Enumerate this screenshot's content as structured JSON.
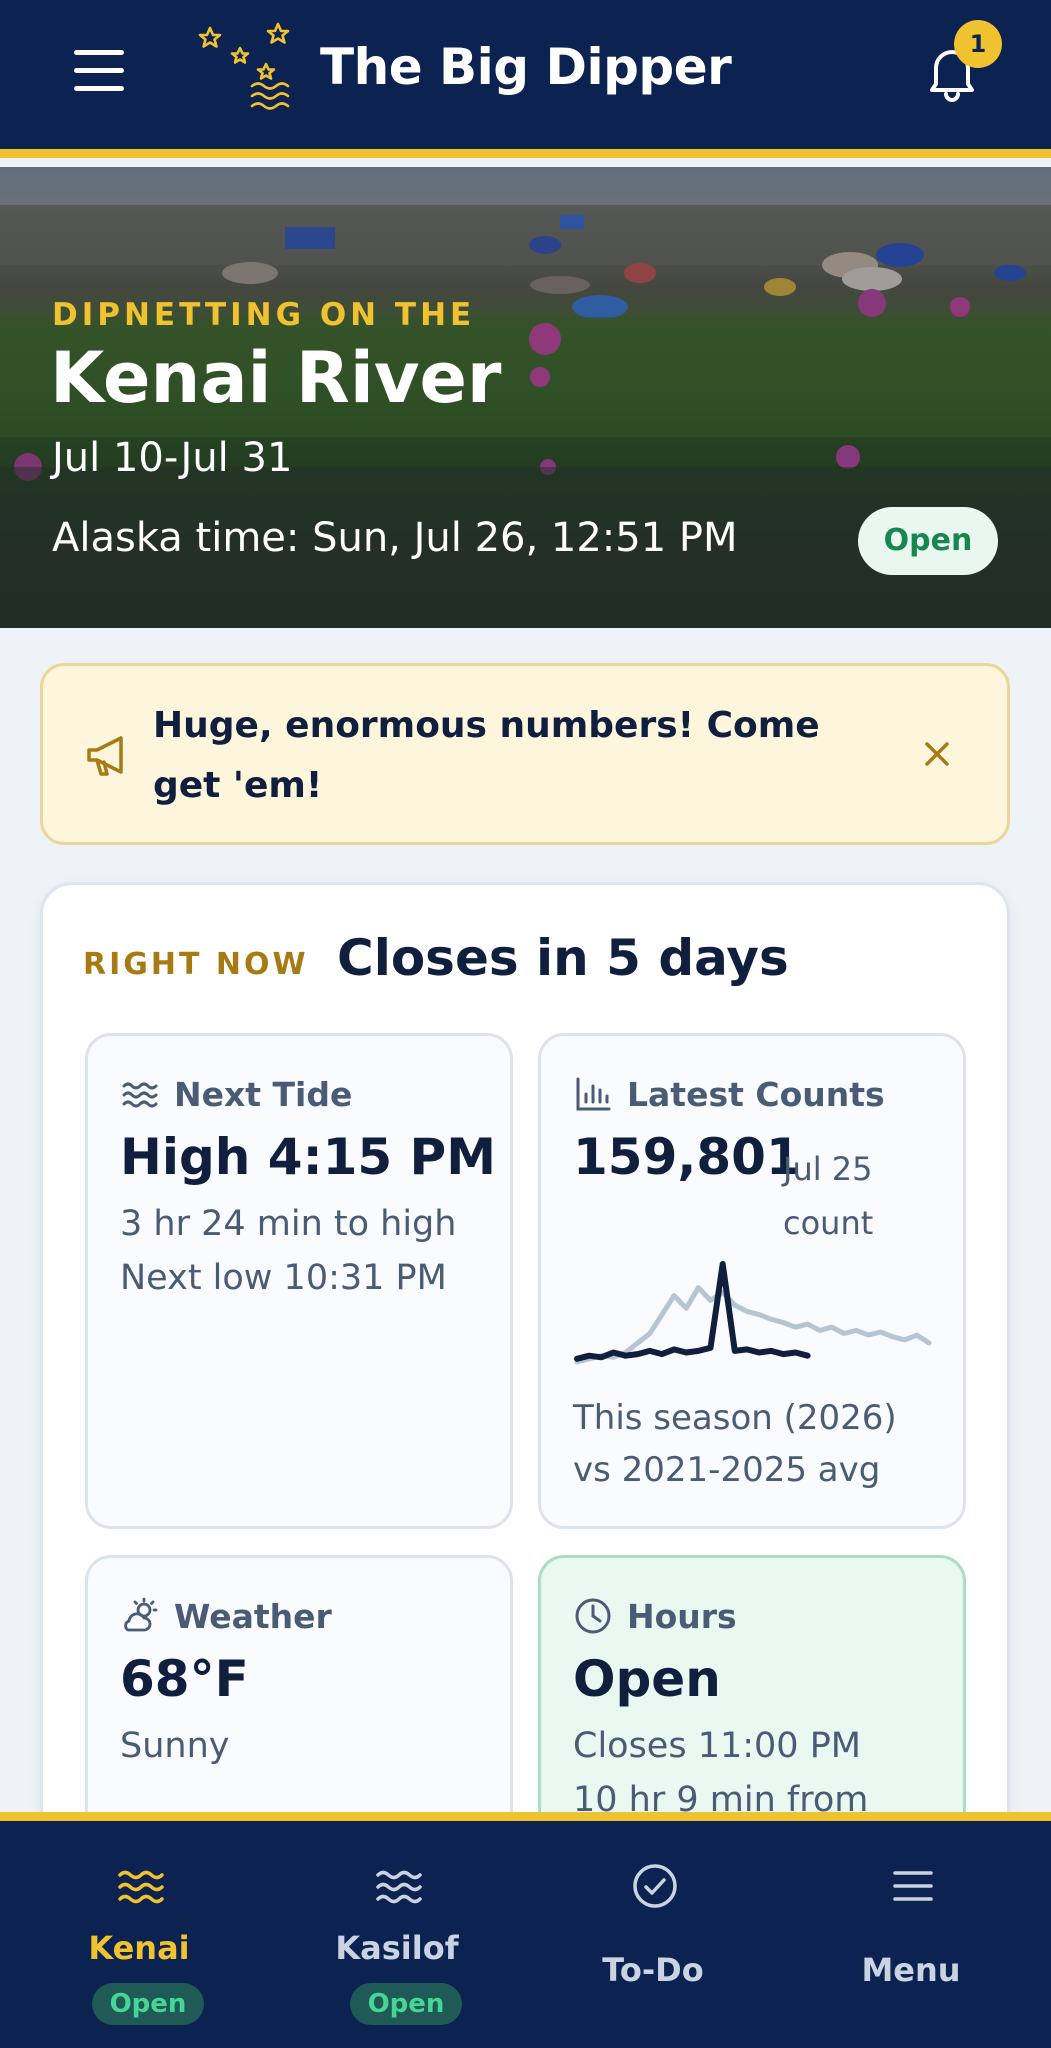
{
  "header": {
    "title": "The Big Dipper",
    "notification_count": "1",
    "icons": {
      "menu": "hamburger-icon",
      "logo": "big-dipper-logo",
      "notifications": "bell-icon"
    }
  },
  "hero": {
    "eyebrow": "DIPNETTING ON THE",
    "title": "Kenai River",
    "dates": "Jul 10-Jul 31",
    "alaska_time": "Alaska time: Sun, Jul 26, 12:51 PM",
    "status": "Open"
  },
  "announcement": {
    "text": "Huge, enormous numbers! Come get 'em!",
    "icons": {
      "megaphone": "megaphone-icon",
      "close": "close-icon"
    }
  },
  "right_now": {
    "eyebrow": "RIGHT NOW",
    "headline": "Closes in 5 days",
    "tide": {
      "label": "Next Tide",
      "value": "High 4:15 PM",
      "line1": "3 hr 24 min to high",
      "line2": "Next low 10:31 PM",
      "icon": "waves-icon"
    },
    "counts": {
      "label": "Latest Counts",
      "value": "159,801",
      "date_line1": "Jul 25",
      "date_line2": "count",
      "legend_line1": "This season (2026)",
      "legend_line2": "vs 2021-2025 avg",
      "icon": "bar-chart-icon"
    },
    "weather": {
      "label": "Weather",
      "value": "68°F",
      "condition": "Sunny",
      "icon": "partly-sunny-icon"
    },
    "hours": {
      "label": "Hours",
      "value": "Open",
      "line1": "Closes 11:00 PM",
      "line2": "10 hr 9 min from",
      "icon": "clock-icon"
    }
  },
  "bottom_nav": [
    {
      "label": "Kenai",
      "status": "Open",
      "active": true,
      "icon": "waves-icon"
    },
    {
      "label": "Kasilof",
      "status": "Open",
      "active": false,
      "icon": "waves-icon"
    },
    {
      "label": "To-Do",
      "active": false,
      "icon": "check-circle-icon"
    },
    {
      "label": "Menu",
      "active": false,
      "icon": "menu-icon"
    }
  ],
  "colors": {
    "navy": "#0c2250",
    "gold": "#f1c230",
    "open_green": "#17874f",
    "alert_bg": "#fdf5dc"
  },
  "chart_data": {
    "type": "line",
    "series": [
      {
        "values": [
          10,
          12,
          11,
          14,
          12,
          13,
          15,
          13,
          16,
          14,
          15,
          17,
          70,
          15,
          16,
          14,
          15,
          13,
          14,
          12
        ]
      },
      {
        "values": [
          8,
          10,
          12,
          11,
          14,
          20,
          26,
          38,
          50,
          42,
          55,
          47,
          52,
          44,
          40,
          38,
          35,
          33,
          30,
          32,
          28,
          30,
          26,
          28,
          25,
          27,
          24,
          22,
          25,
          20
        ]
      }
    ]
  }
}
